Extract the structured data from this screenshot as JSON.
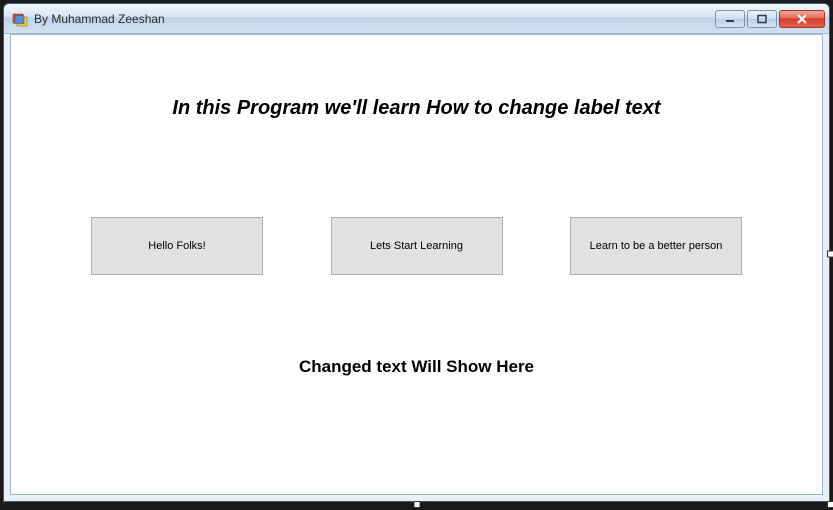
{
  "window": {
    "title": "By Muhammad Zeeshan"
  },
  "heading": "In this Program we'll learn How to change label text",
  "buttons": {
    "b1": "Hello Folks!",
    "b2": "Lets Start Learning",
    "b3": "Learn to be a better person"
  },
  "output_label": "Changed text Will Show Here"
}
